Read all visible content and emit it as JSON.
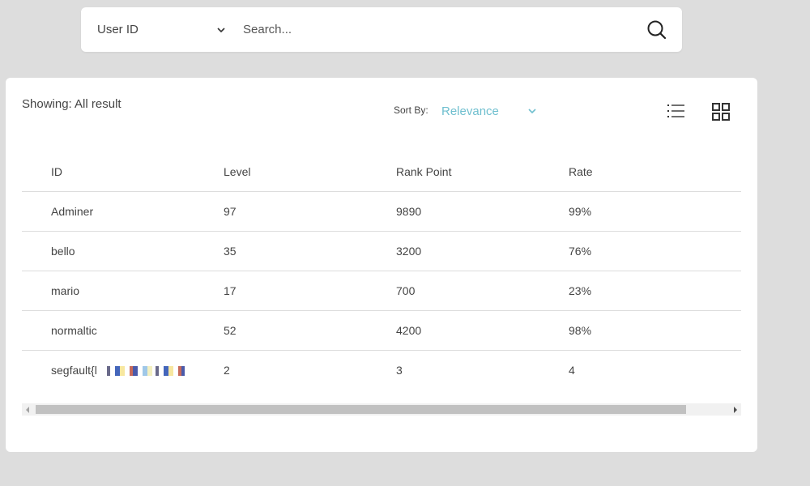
{
  "search": {
    "filter_selected": "User ID",
    "placeholder": "Search...",
    "value": ""
  },
  "results": {
    "showing_text": "Showing: All result",
    "sort_label": "Sort By:",
    "sort_selected": "Relevance"
  },
  "colors": {
    "accent": "#6fbfcf",
    "background": "#dddddd",
    "panel": "#ffffff"
  },
  "icons": {
    "search": "search-icon",
    "list_view": "list-view-icon",
    "grid_view": "grid-view-icon",
    "chevron": "chevron-down-icon"
  },
  "table": {
    "headers": [
      "ID",
      "Level",
      "Rank Point",
      "Rate"
    ],
    "rows": [
      [
        "Adminer",
        "97",
        "9890",
        "99%"
      ],
      [
        "bello",
        "35",
        "3200",
        "76%"
      ],
      [
        "mario",
        "17",
        "700",
        "23%"
      ],
      [
        "normaltic",
        "52",
        "4200",
        "98%"
      ],
      [
        "segfault{l",
        "2",
        "3",
        "4"
      ]
    ]
  },
  "scrollbar": {
    "horizontal_position": 0.0
  }
}
